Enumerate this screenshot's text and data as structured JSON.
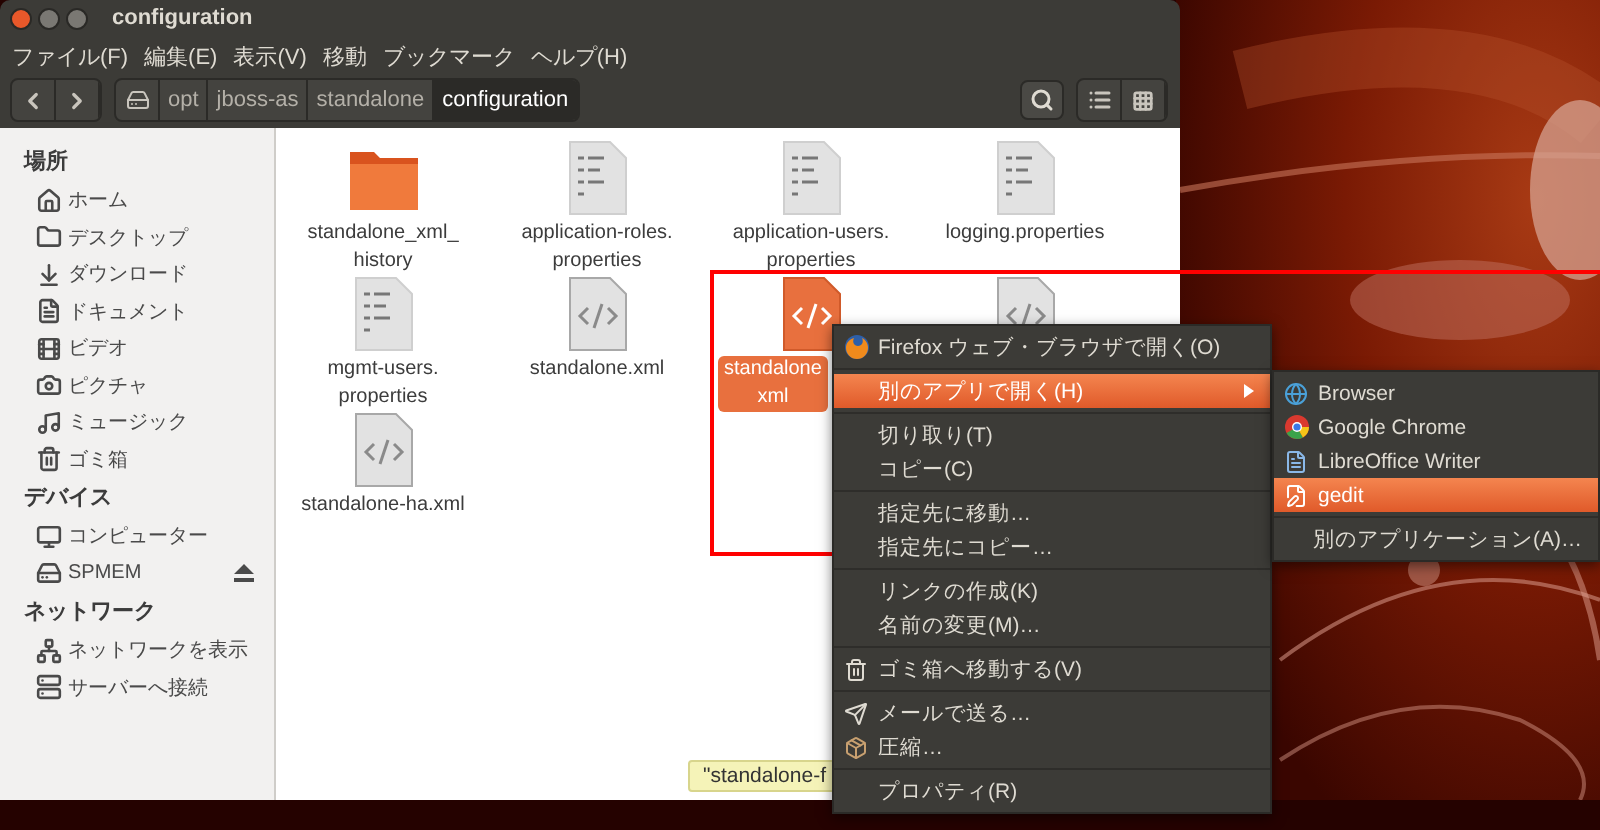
{
  "window": {
    "title": "configuration"
  },
  "menubar": [
    "ファイル(F)",
    "編集(E)",
    "表示(V)",
    "移動",
    "ブックマーク",
    "ヘルプ(H)"
  ],
  "path": [
    {
      "label": "opt",
      "selected": false
    },
    {
      "label": "jboss-as",
      "selected": false
    },
    {
      "label": "standalone",
      "selected": false
    },
    {
      "label": "configuration",
      "selected": true
    }
  ],
  "sidebar": [
    {
      "heading": "場所",
      "items": [
        {
          "label": "ホーム",
          "eject": false
        },
        {
          "label": "デスクトップ",
          "eject": false
        },
        {
          "label": "ダウンロード",
          "eject": false
        },
        {
          "label": "ドキュメント",
          "eject": false
        },
        {
          "label": "ビデオ",
          "eject": false
        },
        {
          "label": "ピクチャ",
          "eject": false
        },
        {
          "label": "ミュージック",
          "eject": false
        },
        {
          "label": "ゴミ箱",
          "eject": false
        }
      ]
    },
    {
      "heading": "デバイス",
      "items": [
        {
          "label": "コンピューター",
          "eject": false
        },
        {
          "label": "SPMEM",
          "eject": true
        }
      ]
    },
    {
      "heading": "ネットワーク",
      "items": [
        {
          "label": "ネットワークを表示",
          "eject": false
        },
        {
          "label": "サーバーへ接続",
          "eject": false
        }
      ]
    }
  ],
  "files": [
    {
      "kind": "folder",
      "lines": [
        "standalone_xml_",
        "history"
      ],
      "selected": false
    },
    {
      "kind": "text",
      "lines": [
        "application-roles.",
        "properties"
      ],
      "selected": false
    },
    {
      "kind": "text",
      "lines": [
        "application-users.",
        "properties"
      ],
      "selected": false
    },
    {
      "kind": "text",
      "lines": [
        "logging.properties"
      ],
      "selected": false
    },
    {
      "kind": "text",
      "lines": [
        "mgmt-users.",
        "properties"
      ],
      "selected": false
    },
    {
      "kind": "xml",
      "lines": [
        "standalone.xml"
      ],
      "selected": false
    },
    {
      "kind": "xml",
      "lines": [
        "standalone",
        "xml"
      ],
      "selected": true
    },
    {
      "kind": "xml",
      "selected": false
    },
    {
      "kind": "xml",
      "lines": [
        "standalone-ha.xml"
      ],
      "selected": false
    }
  ],
  "tooltip": "\"standalone-f",
  "context_menu": [
    {
      "kind": "item",
      "label": "Firefox ウェブ・ブラウザで開く(O)",
      "selected": false
    },
    {
      "kind": "separator"
    },
    {
      "kind": "submenu",
      "label": "別のアプリで開く(H)",
      "selected": true
    },
    {
      "kind": "separator"
    },
    {
      "kind": "item",
      "label": "切り取り(T)",
      "selected": false
    },
    {
      "kind": "item",
      "label": "コピー(C)",
      "selected": false
    },
    {
      "kind": "separator"
    },
    {
      "kind": "item",
      "label": "指定先に移動…",
      "selected": false
    },
    {
      "kind": "item",
      "label": "指定先にコピー…",
      "selected": false
    },
    {
      "kind": "separator"
    },
    {
      "kind": "item",
      "label": "リンクの作成(K)",
      "selected": false
    },
    {
      "kind": "item",
      "label": "名前の変更(M)…",
      "selected": false
    },
    {
      "kind": "separator"
    },
    {
      "kind": "item",
      "label": "ゴミ箱へ移動する(V)",
      "selected": false
    },
    {
      "kind": "separator"
    },
    {
      "kind": "item",
      "label": "メールで送る…",
      "selected": false
    },
    {
      "kind": "item",
      "label": "圧縮…",
      "selected": false
    },
    {
      "kind": "separator"
    },
    {
      "kind": "item",
      "label": "プロパティ(R)",
      "selected": false
    }
  ],
  "submenu": [
    {
      "kind": "item",
      "label": "Browser",
      "selected": false
    },
    {
      "kind": "item",
      "label": "Google Chrome",
      "selected": false
    },
    {
      "kind": "item",
      "label": "LibreOffice Writer",
      "selected": false
    },
    {
      "kind": "item",
      "label": "gedit",
      "selected": true
    },
    {
      "kind": "separator"
    },
    {
      "kind": "item",
      "label": "別のアプリケーション(A)…",
      "selected": false
    }
  ],
  "highlight_frame": true
}
